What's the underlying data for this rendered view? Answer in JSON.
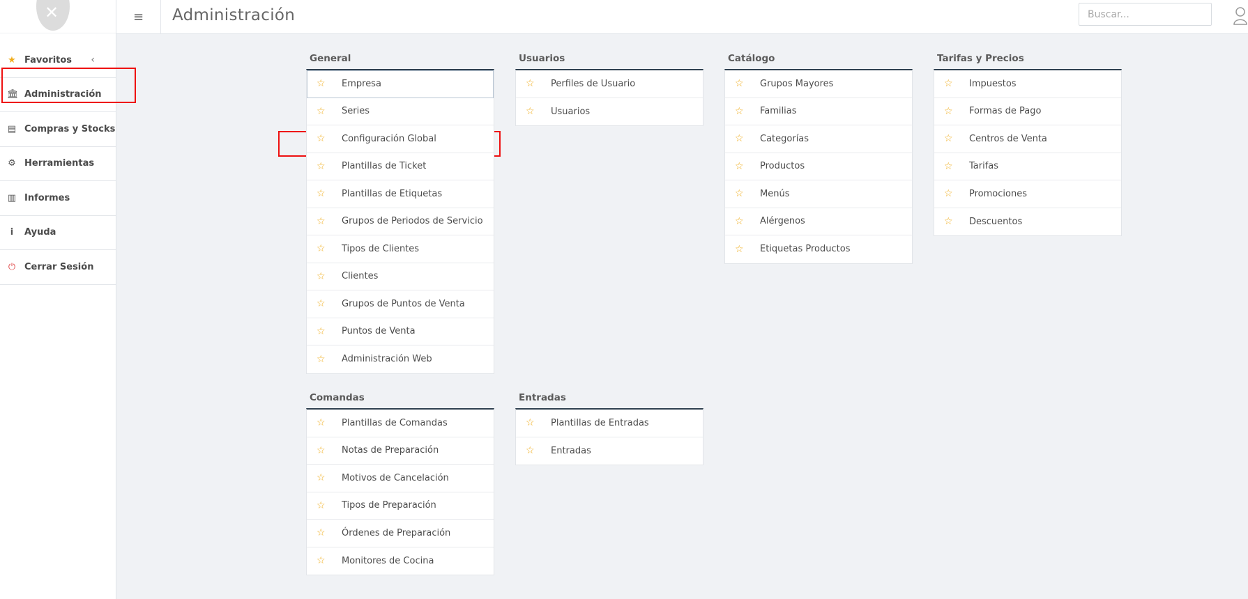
{
  "colors": {
    "accent_star": "#f0ad1c",
    "highlight": "#ee1111",
    "panel_top_border": "#2f4050",
    "logout_icon": "#e04b4b"
  },
  "sidebar": {
    "items": [
      {
        "label": "Favoritos",
        "icon": "star-icon"
      },
      {
        "label": "Administración",
        "icon": "bank-icon"
      },
      {
        "label": "Compras y Stocks",
        "icon": "building-icon"
      },
      {
        "label": "Herramientas",
        "icon": "gears-icon"
      },
      {
        "label": "Informes",
        "icon": "bar-chart-icon"
      },
      {
        "label": "Ayuda",
        "icon": "info-icon"
      },
      {
        "label": "Cerrar Sesión",
        "icon": "power-icon"
      }
    ]
  },
  "header": {
    "title": "Administración",
    "search_placeholder": "Buscar..."
  },
  "sections": [
    {
      "title": "General",
      "items": [
        "Empresa",
        "Series",
        "Configuración Global",
        "Plantillas de Ticket",
        "Plantillas de Etiquetas",
        "Grupos de Periodos de Servicio",
        "Tipos de Clientes",
        "Clientes",
        "Grupos de Puntos de Venta",
        "Puntos de Venta",
        "Administración Web"
      ]
    },
    {
      "title": "Usuarios",
      "items": [
        "Perfiles de Usuario",
        "Usuarios"
      ]
    },
    {
      "title": "Catálogo",
      "items": [
        "Grupos Mayores",
        "Familias",
        "Categorías",
        "Productos",
        "Menús",
        "Alérgenos",
        "Etiquetas Productos"
      ]
    },
    {
      "title": "Tarifas y Precios",
      "items": [
        "Impuestos",
        "Formas de Pago",
        "Centros de Venta",
        "Tarifas",
        "Promociones",
        "Descuentos"
      ]
    },
    {
      "title": "Comandas",
      "items": [
        "Plantillas de Comandas",
        "Notas de Preparación",
        "Motivos de Cancelación",
        "Tipos de Preparación",
        "Órdenes de Preparación",
        "Monitores de Cocina"
      ]
    },
    {
      "title": "Entradas",
      "items": [
        "Plantillas de Entradas",
        "Entradas"
      ]
    }
  ]
}
